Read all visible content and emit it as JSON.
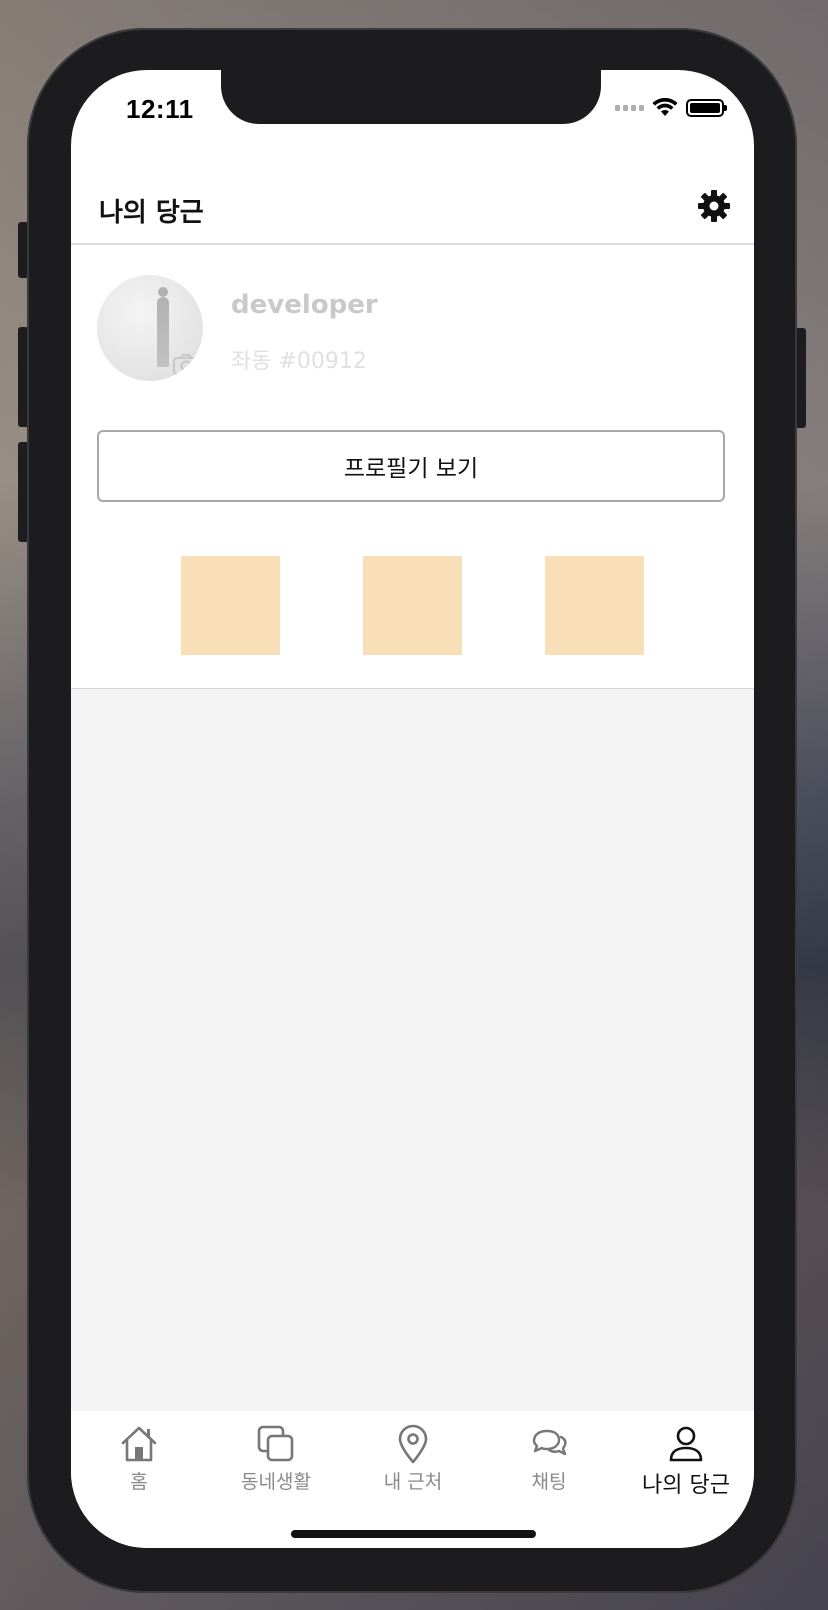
{
  "status_bar": {
    "time": "12:11"
  },
  "header": {
    "title": "나의 당근",
    "settings_icon": "gear-icon"
  },
  "profile": {
    "username": "developer",
    "location": "좌동 #00912",
    "avatar_icon": "avatar",
    "camera_icon": "camera-icon",
    "view_profile_label": "프로필기 보기"
  },
  "tiles": {
    "color": "#f8dfb8",
    "count": 3
  },
  "tabbar": {
    "items": [
      {
        "label": "홈",
        "icon": "home-icon"
      },
      {
        "label": "동네생활",
        "icon": "community-icon"
      },
      {
        "label": "내 근처",
        "icon": "location-pin-icon"
      },
      {
        "label": "채팅",
        "icon": "chat-icon"
      },
      {
        "label": "나의 당근",
        "icon": "user-icon",
        "active": true
      }
    ]
  },
  "colors": {
    "accent_tile": "#f8dfb8",
    "background_gray": "#f3f3f3",
    "active_tab": "#111111",
    "inactive_tab": "#8a8a8a"
  }
}
